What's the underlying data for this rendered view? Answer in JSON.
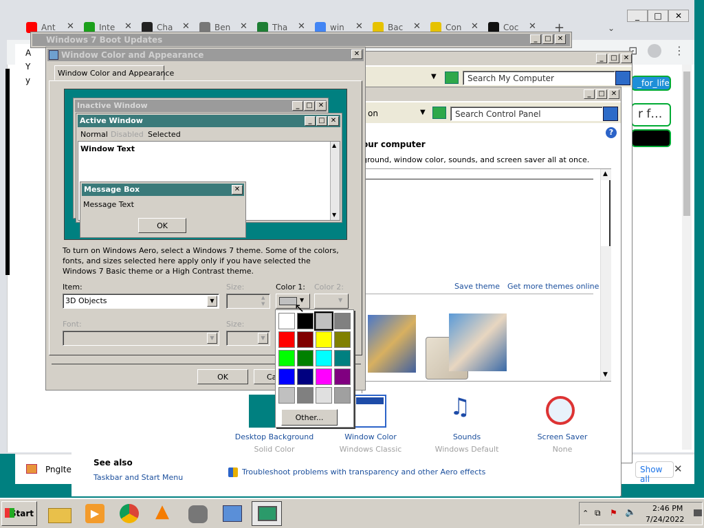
{
  "chrome": {
    "tabs": [
      {
        "label": "Ant",
        "color": "#ff0000"
      },
      {
        "label": "Inte",
        "color": "#1ba01b"
      },
      {
        "label": "Cha",
        "color": "#222222"
      },
      {
        "label": "Ben",
        "color": "#777777"
      },
      {
        "label": "Tha",
        "color": "#1e7e34"
      },
      {
        "label": "win",
        "color": "#4285f4"
      },
      {
        "label": "Bac",
        "color": "#e6c200"
      },
      {
        "label": "Con",
        "color": "#e6c200"
      },
      {
        "label": "Coc",
        "color": "#111111"
      }
    ],
    "new_tab": "+",
    "page_snippets": [
      "A",
      "Y",
      "y"
    ],
    "right_button": "_for_life",
    "right_text": "r f…",
    "footer_file": "PngIte",
    "show_all": "Show all",
    "close": "✕"
  },
  "boot_window": {
    "title": "Windows 7 Boot Updates"
  },
  "computer_window": {
    "search_placeholder": "Search My Computer"
  },
  "control_panel": {
    "search_placeholder": "Search Control Panel",
    "address_tail": "on",
    "heading": "our computer",
    "desc": "ground, window color, sounds, and screen saver all at once.",
    "save_theme": "Save theme",
    "get_more": "Get more themes online",
    "bottom_items": [
      {
        "label": "Desktop Background",
        "sub": "Solid Color"
      },
      {
        "label": "Window Color",
        "sub": "Windows Classic"
      },
      {
        "label": "Sounds",
        "sub": "Windows Default"
      },
      {
        "label": "Screen Saver",
        "sub": "None"
      }
    ],
    "see_also": "See also",
    "taskbar_link": "Taskbar and Start Menu",
    "troubleshoot": "Troubleshoot problems with transparency and other Aero effects"
  },
  "dialog": {
    "title": "Window Color and Appearance",
    "tab": "Window Color and Appearance",
    "preview": {
      "inactive": "Inactive Window",
      "active": "Active Window",
      "menu": [
        "Normal",
        "Disabled",
        "Selected"
      ],
      "window_text": "Window Text",
      "msgbox_title": "Message Box",
      "msgbox_text": "Message Text",
      "ok": "OK"
    },
    "info": "To turn on Windows Aero, select a Windows 7 theme.  Some of the colors, fonts, and sizes selected here apply only if you have selected the Windows 7 Basic theme or a High Contrast theme.",
    "item_label": "Item:",
    "item_value": "3D Objects",
    "size_label": "Size:",
    "color1_label": "Color 1:",
    "color2_label": "Color 2:",
    "font_label": "Font:",
    "size2_label": "Size:",
    "ok": "OK",
    "cancel": "Ca"
  },
  "palette": {
    "colors": [
      "#ffffff",
      "#000000",
      "#c0c0c0",
      "#808080",
      "#ff0000",
      "#800000",
      "#ffff00",
      "#808000",
      "#00ff00",
      "#008000",
      "#00ffff",
      "#008080",
      "#0000ff",
      "#000080",
      "#ff00ff",
      "#800080",
      "#c0c0c0",
      "#808080",
      "#e0e0e0",
      "#a0a0a0"
    ],
    "other": "Other..."
  },
  "taskbar": {
    "start": "Start",
    "time": "2:46 PM",
    "date": "7/24/2022"
  }
}
